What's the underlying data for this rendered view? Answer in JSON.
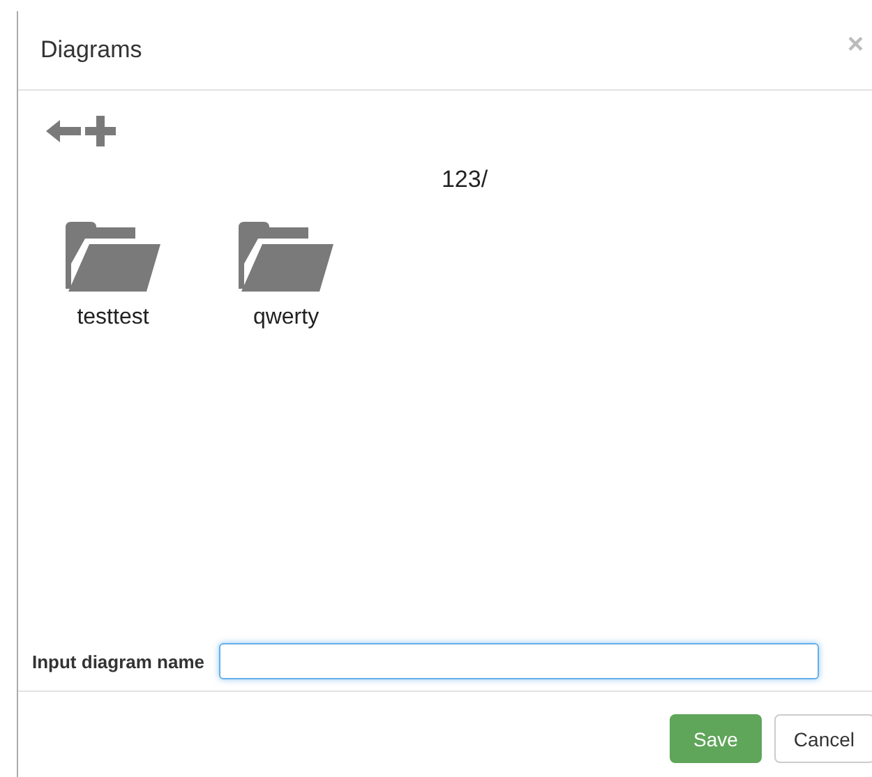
{
  "dialog": {
    "title": "Diagrams",
    "close": "×"
  },
  "toolbar": {
    "current_path": "123/"
  },
  "folders": [
    {
      "name": "testtest"
    },
    {
      "name": "qwerty"
    }
  ],
  "name_field": {
    "label": "Input diagram name"
  },
  "buttons": [
    {
      "label": "Save",
      "kind": "primary"
    },
    {
      "label": "Cancel",
      "kind": "default"
    }
  ]
}
